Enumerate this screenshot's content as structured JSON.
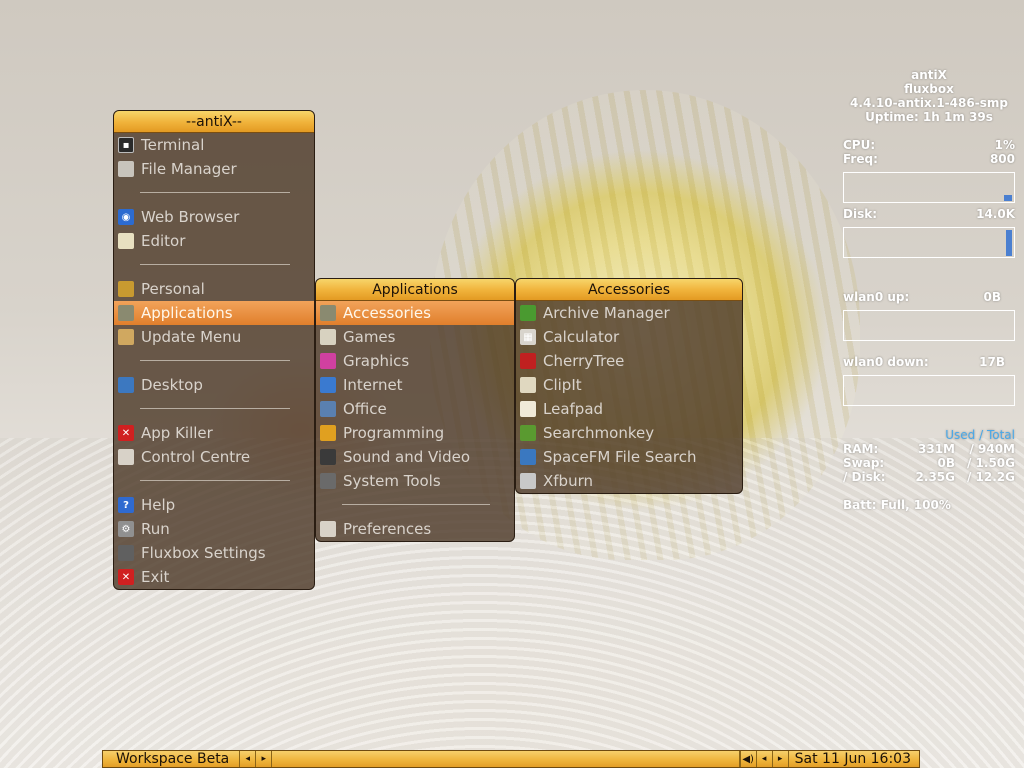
{
  "main_menu": {
    "title": "--antiX--",
    "items": [
      {
        "label": "Terminal",
        "icon": "terminal-icon",
        "color": "#2a2a2a"
      },
      {
        "label": "File Manager",
        "icon": "file-manager-icon",
        "color": "#c8c4bc"
      },
      {
        "sep": true
      },
      {
        "label": "Web Browser",
        "icon": "web-browser-icon",
        "color": "#2c6bd0"
      },
      {
        "label": "Editor",
        "icon": "editor-icon",
        "color": "#e8e0c0"
      },
      {
        "sep": true
      },
      {
        "label": "Personal",
        "icon": "personal-icon",
        "color": "#c89a30"
      },
      {
        "label": "Applications",
        "icon": "applications-icon",
        "color": "#8a8a70",
        "active": true
      },
      {
        "label": "Update Menu",
        "icon": "update-menu-icon",
        "color": "#d0a860"
      },
      {
        "sep": true
      },
      {
        "label": "Desktop",
        "icon": "desktop-icon",
        "color": "#3c78c0"
      },
      {
        "sep": true
      },
      {
        "label": "App Killer",
        "icon": "app-killer-icon",
        "color": "#d02020"
      },
      {
        "label": "Control Centre",
        "icon": "control-centre-icon",
        "color": "#d8d2c8"
      },
      {
        "sep": true
      },
      {
        "label": "Help",
        "icon": "help-icon",
        "color": "#2f6ad0"
      },
      {
        "label": "Run",
        "icon": "run-gear-icon",
        "color": "#909090"
      },
      {
        "label": "Fluxbox Settings",
        "icon": "fluxbox-settings-icon",
        "color": "#606060"
      },
      {
        "label": "Exit",
        "icon": "exit-icon",
        "color": "#d02020"
      }
    ]
  },
  "applications_menu": {
    "title": "Applications",
    "items": [
      {
        "label": "Accessories",
        "icon": "accessories-icon",
        "color": "#8a8a70",
        "active": true
      },
      {
        "label": "Games",
        "icon": "games-icon",
        "color": "#d8d2c0"
      },
      {
        "label": "Graphics",
        "icon": "graphics-icon",
        "color": "#d040a0"
      },
      {
        "label": "Internet",
        "icon": "internet-icon",
        "color": "#3a7ad0"
      },
      {
        "label": "Office",
        "icon": "office-icon",
        "color": "#5a80b0"
      },
      {
        "label": "Programming",
        "icon": "programming-icon",
        "color": "#e0a020"
      },
      {
        "label": "Sound and Video",
        "icon": "sound-video-icon",
        "color": "#3a3a3a"
      },
      {
        "label": "System Tools",
        "icon": "system-tools-icon",
        "color": "#6a6a6a"
      },
      {
        "sep": true
      },
      {
        "label": "Preferences",
        "icon": "preferences-icon",
        "color": "#d8d2c8"
      }
    ]
  },
  "accessories_menu": {
    "title": "Accessories",
    "items": [
      {
        "label": "Archive Manager",
        "icon": "archive-manager-icon",
        "color": "#4a9a30"
      },
      {
        "label": "Calculator",
        "icon": "calculator-icon",
        "color": "#d8d4cc"
      },
      {
        "label": "CherryTree",
        "icon": "cherrytree-icon",
        "color": "#c02020"
      },
      {
        "label": "ClipIt",
        "icon": "clipit-icon",
        "color": "#e0d8c0"
      },
      {
        "label": "Leafpad",
        "icon": "leafpad-icon",
        "color": "#f0ead8"
      },
      {
        "label": "Searchmonkey",
        "icon": "searchmonkey-icon",
        "color": "#5a9a30"
      },
      {
        "label": "SpaceFM File Search",
        "icon": "spacefm-search-icon",
        "color": "#3a78c0"
      },
      {
        "label": "Xfburn",
        "icon": "xfburn-icon",
        "color": "#c8c8c8"
      }
    ]
  },
  "conky": {
    "distro": "antiX",
    "wm": "fluxbox",
    "kernel": "4.4.10-antix.1-486-smp",
    "uptime": "Uptime: 1h 1m 39s",
    "cpu_label": "CPU:",
    "cpu_value": "1%",
    "freq_label": "Freq:",
    "freq_value": "800",
    "disk_label": "Disk:",
    "disk_value": "14.0K",
    "wlan_up_label": "wlan0 up:",
    "wlan_up_value": "0B",
    "wlan_down_label": "wlan0 down:",
    "wlan_down_value": "17B",
    "mem_header": "Used / Total",
    "ram_label": "RAM:",
    "ram_used": "331M",
    "ram_total": "/ 940M",
    "swap_label": "Swap:",
    "swap_used": "0B",
    "swap_total": "/ 1.50G",
    "disk2_label": "/ Disk:",
    "disk2_used": "2.35G",
    "disk2_total": "/ 12.2G",
    "batt": "Batt: Full, 100%",
    "accent": "#4aa8e8"
  },
  "taskbar": {
    "workspace": "Workspace Beta",
    "prev_icon": "◂",
    "next_icon": "▸",
    "volume_icon": "🔊",
    "clock": "Sat 11 Jun   16:03"
  }
}
